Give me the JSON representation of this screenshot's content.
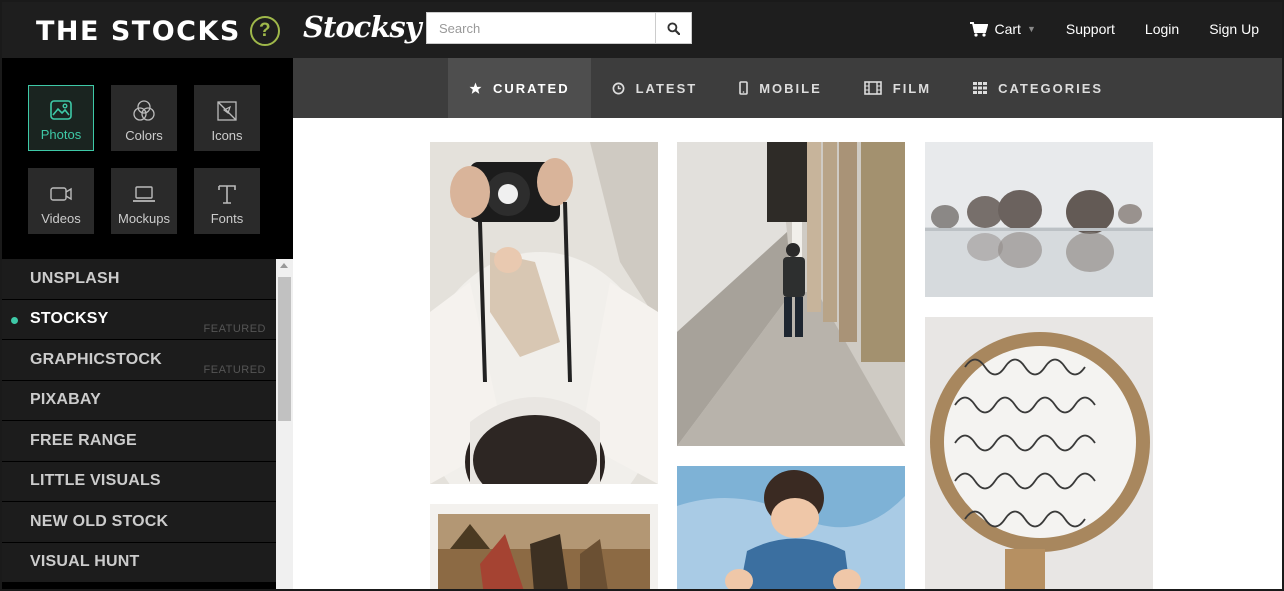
{
  "header": {
    "brand": "THE STOCKS",
    "help_glyph": "?",
    "partner_logo": "Stocksy",
    "search_placeholder": "Search",
    "nav": {
      "cart": "Cart",
      "support": "Support",
      "login": "Login",
      "signup": "Sign Up"
    }
  },
  "sidebar": {
    "tiles": [
      {
        "label": "Photos",
        "icon": "photo-icon",
        "active": true
      },
      {
        "label": "Colors",
        "icon": "color-circles-icon",
        "active": false
      },
      {
        "label": "Icons",
        "icon": "icons-icon",
        "active": false
      },
      {
        "label": "Videos",
        "icon": "video-camera-icon",
        "active": false
      },
      {
        "label": "Mockups",
        "icon": "laptop-icon",
        "active": false
      },
      {
        "label": "Fonts",
        "icon": "font-icon",
        "active": false
      }
    ],
    "sources": [
      {
        "label": "UNSPLASH",
        "badge": ""
      },
      {
        "label": "STOCKSY",
        "badge": "FEATURED",
        "active": true
      },
      {
        "label": "GRAPHICSTOCK",
        "badge": "FEATURED"
      },
      {
        "label": "PIXABAY",
        "badge": ""
      },
      {
        "label": "FREE RANGE",
        "badge": ""
      },
      {
        "label": "LITTLE VISUALS",
        "badge": ""
      },
      {
        "label": "NEW OLD STOCK",
        "badge": ""
      },
      {
        "label": "VISUAL HUNT",
        "badge": ""
      }
    ]
  },
  "category_tabs": [
    {
      "label": "CURATED",
      "icon": "star-icon",
      "active": true
    },
    {
      "label": "LATEST",
      "icon": "clock-icon",
      "active": false
    },
    {
      "label": "MOBILE",
      "icon": "mobile-icon",
      "active": false
    },
    {
      "label": "FILM",
      "icon": "film-icon",
      "active": false
    },
    {
      "label": "CATEGORIES",
      "icon": "grid-icon",
      "active": false
    }
  ],
  "colors": {
    "accent": "#3ec9a7",
    "help_ring": "#9fb84a",
    "topbar": "#1e1e1e",
    "catbar": "#3d3d3d"
  }
}
